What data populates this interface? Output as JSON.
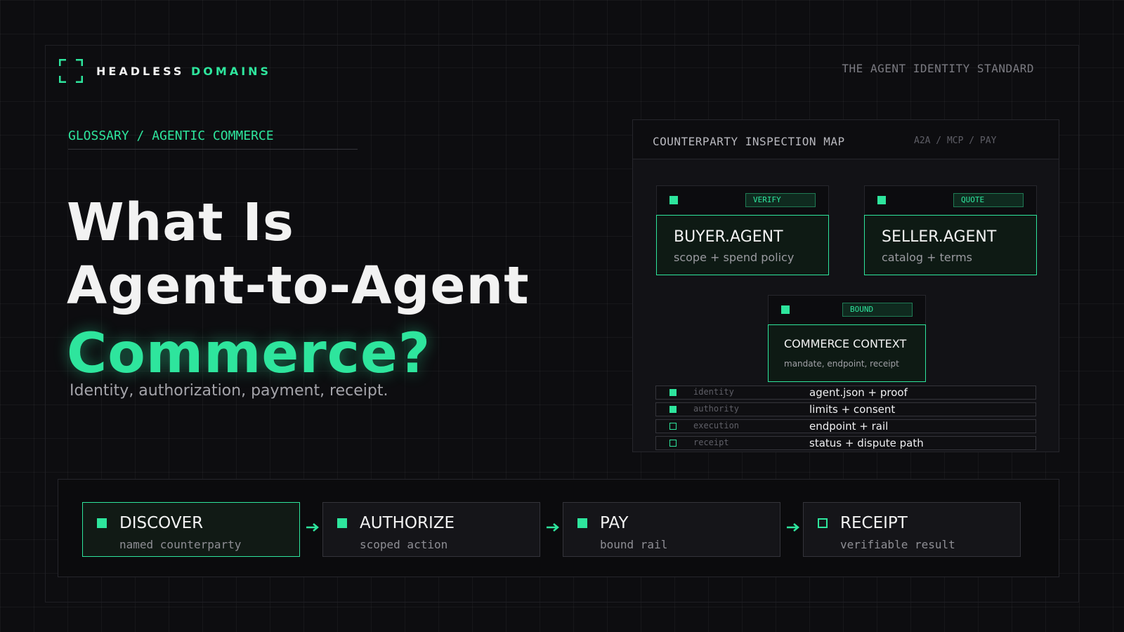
{
  "brand": {
    "name_part1": "HEADLESS",
    "name_part2": "DOMAINS",
    "logo": "bracket-frame-icon",
    "accent_color": "#2ee59d"
  },
  "header": {
    "tagline": "THE AGENT IDENTITY STANDARD"
  },
  "hero": {
    "breadcrumb": "GLOSSARY / AGENTIC COMMERCE",
    "title_line1": "What Is",
    "title_line2": "Agent-to-Agent",
    "title_accent": "Commerce?",
    "subtitle": "Identity, authorization, payment, receipt."
  },
  "map": {
    "title": "COUNTERPARTY INSPECTION MAP",
    "protocols": "A2A / MCP / PAY",
    "buyer": {
      "badge": "VERIFY",
      "title": "BUYER.AGENT",
      "sub": "scope + spend policy"
    },
    "seller": {
      "badge": "QUOTE",
      "title": "SELLER.AGENT",
      "sub": "catalog + terms"
    },
    "context": {
      "badge": "BOUND",
      "title": "COMMERCE CONTEXT",
      "sub": "mandate, endpoint, receipt"
    },
    "rows": [
      {
        "key": "identity",
        "value": "agent.json + proof",
        "checked": true
      },
      {
        "key": "authority",
        "value": "limits + consent",
        "checked": true
      },
      {
        "key": "execution",
        "value": "endpoint + rail",
        "checked": false
      },
      {
        "key": "receipt",
        "value": "status + dispute path",
        "checked": false
      }
    ]
  },
  "flow": {
    "steps": [
      {
        "title": "DISCOVER",
        "sub": "named counterparty",
        "state": "active"
      },
      {
        "title": "AUTHORIZE",
        "sub": "scoped action",
        "state": "done"
      },
      {
        "title": "PAY",
        "sub": "bound rail",
        "state": "done"
      },
      {
        "title": "RECEIPT",
        "sub": "verifiable result",
        "state": "pending"
      }
    ]
  }
}
